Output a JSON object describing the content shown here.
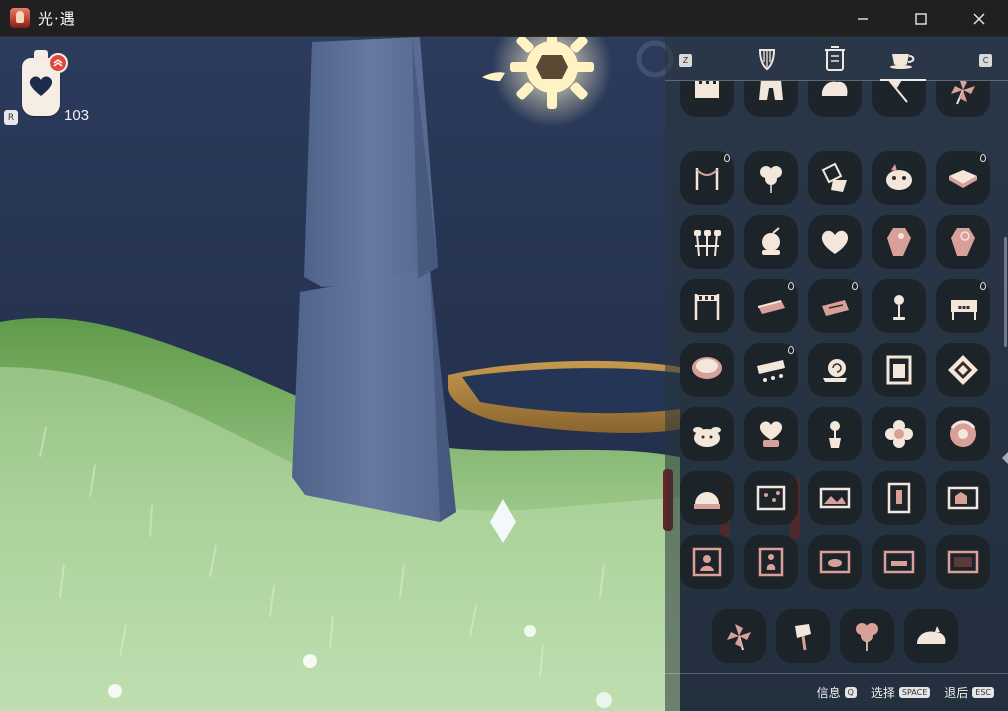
{
  "window": {
    "title": "光·遇",
    "controls": [
      "minimize",
      "maximize",
      "close"
    ]
  },
  "hud": {
    "candle_key": "R",
    "candle_count": "103",
    "candle_icon": "candle-heart-icon",
    "badge_icon": "upgrade-chevrons-icon"
  },
  "panel": {
    "left_key": "Z",
    "right_key": "C",
    "tabs": [
      {
        "icon": "harp-icon",
        "active": false
      },
      {
        "icon": "lantern-icon",
        "active": false
      },
      {
        "icon": "teacup-icon",
        "active": true
      }
    ],
    "rows": [
      [
        "fence-icon",
        "gate-icon",
        "boulder-icon",
        "flag-icon",
        "pinwheel-icon"
      ],
      [
        "rope-barrier-icon",
        "balloons-icon",
        "cone-lamp-icon",
        "creature-cushion-icon",
        "tray-icon"
      ],
      [
        "marshmallow-sticks-icon",
        "cauldron-icon",
        "heart-pillow-icon",
        "coffin-icon",
        "coffin-ornate-icon"
      ],
      [
        "finish-arch-icon",
        "plank-icon",
        "sign-board-icon",
        "microphone-icon",
        "banner-sign-icon"
      ],
      [
        "hot-pot-icon",
        "stall-icon",
        "snail-icon",
        "portrait-frame-icon",
        "diamond-sign-icon"
      ],
      [
        "puppy-icon",
        "heart-lamp-icon",
        "potted-flower-icon",
        "flower-cushion-icon",
        "donut-icon"
      ],
      [
        "dome-icon",
        "painting-flowers-icon",
        "painting-landscape-icon",
        "painting-figure-icon",
        "painting-house-icon"
      ],
      [
        "painting-portrait-icon",
        "painting-vase-icon",
        "painting-dog-icon",
        "painting-table-icon",
        "painting-dark-icon"
      ],
      [
        "pinwheel-small-icon",
        "shell-lamp-icon",
        "balloon-cluster-icon",
        "sleeping-cat-icon"
      ]
    ],
    "drop_marks": [
      [
        0,
        4
      ],
      [
        1,
        0
      ],
      [
        1,
        4
      ],
      [
        3,
        1
      ],
      [
        3,
        2
      ],
      [
        3,
        4
      ],
      [
        4,
        1
      ]
    ],
    "footer": [
      {
        "label": "信息",
        "key": "Q"
      },
      {
        "label": "选择",
        "key": "SPACE"
      },
      {
        "label": "退后",
        "key": "ESC"
      }
    ]
  },
  "colors": {
    "titlebar": "#202020",
    "icon_cream": "#f3e6da",
    "icon_rose": "#d9a09a",
    "sun_glow": "#fff6c8"
  }
}
